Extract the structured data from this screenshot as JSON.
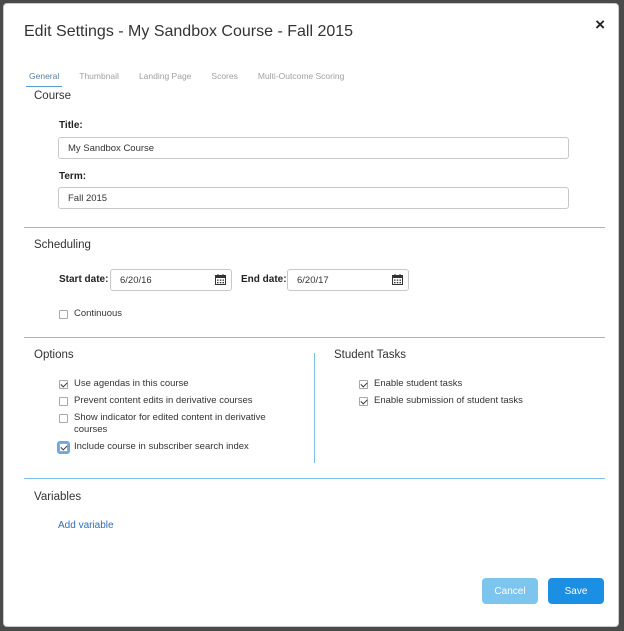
{
  "dialog": {
    "title": "Edit Settings - My Sandbox Course - Fall 2015",
    "close_glyph": "×"
  },
  "tabs": [
    {
      "label": "General",
      "active": true
    },
    {
      "label": "Thumbnail",
      "active": false
    },
    {
      "label": "Landing Page",
      "active": false
    },
    {
      "label": "Scores",
      "active": false
    },
    {
      "label": "Multi-Outcome Scoring",
      "active": false
    }
  ],
  "course": {
    "heading": "Course",
    "title_label": "Title:",
    "title_value": "My Sandbox Course",
    "term_label": "Term:",
    "term_value": "Fall 2015"
  },
  "scheduling": {
    "heading": "Scheduling",
    "start_label": "Start date:",
    "start_value": "6/20/16",
    "end_label": "End date:",
    "end_value": "6/20/17",
    "continuous_label": "Continuous",
    "continuous_checked": false
  },
  "options": {
    "heading": "Options",
    "items": [
      {
        "label": "Use agendas in this course",
        "checked": true
      },
      {
        "label": "Prevent content edits in derivative courses",
        "checked": false
      },
      {
        "label": "Show indicator for edited content in derivative courses",
        "checked": false
      },
      {
        "label": "Include course in subscriber search index",
        "checked": true
      }
    ]
  },
  "student_tasks": {
    "heading": "Student Tasks",
    "items": [
      {
        "label": "Enable student tasks",
        "checked": true
      },
      {
        "label": "Enable submission of student tasks",
        "checked": true
      }
    ]
  },
  "variables": {
    "heading": "Variables",
    "add_link": "Add variable"
  },
  "buttons": {
    "cancel": "Cancel",
    "save": "Save"
  },
  "colors": {
    "accent": "#1a8fe3",
    "accent_light": "#7cc5ef",
    "divider": "#7fc2e8",
    "link": "#2f6db0"
  },
  "icons": {
    "close": "close-icon",
    "calendar": "calendar-icon"
  }
}
